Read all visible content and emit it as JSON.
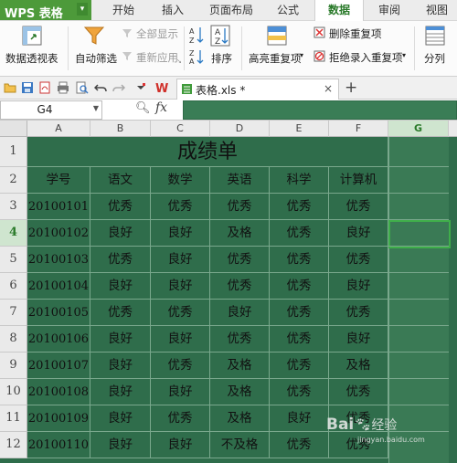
{
  "app": {
    "name": "WPS 表格",
    "caret": "▾"
  },
  "menu_tabs": [
    "开始",
    "插入",
    "页面布局",
    "公式",
    "数据",
    "审阅",
    "视图"
  ],
  "active_tab": "数据",
  "ribbon": {
    "pivot": "数据透视表",
    "autofilter": "自动筛选",
    "show_all": "全部显示",
    "reapply": "重新应用",
    "sort": "排序",
    "highlight_dup": "高亮重复项",
    "remove_dup": "删除重复项",
    "reject_dup": "拒绝录入重复项",
    "split": "分列",
    "dropdown": "▾"
  },
  "document_tab": {
    "name": "表格.xls *",
    "close": "×"
  },
  "new_tab": "+",
  "formula_bar": {
    "cell_ref": "G4",
    "fx": "fx",
    "value": ""
  },
  "columns": [
    "A",
    "B",
    "C",
    "D",
    "E",
    "F",
    "G"
  ],
  "selected_column": "G",
  "selected_row": "4",
  "sheet": {
    "title": "成绩单",
    "headers": [
      "学号",
      "语文",
      "数学",
      "英语",
      "科学",
      "计算机"
    ],
    "rows": [
      {
        "num": "3",
        "cells": [
          "20100101",
          "优秀",
          "优秀",
          "优秀",
          "优秀",
          "优秀"
        ]
      },
      {
        "num": "4",
        "cells": [
          "20100102",
          "良好",
          "良好",
          "及格",
          "优秀",
          "良好"
        ]
      },
      {
        "num": "5",
        "cells": [
          "20100103",
          "优秀",
          "良好",
          "优秀",
          "优秀",
          "优秀"
        ]
      },
      {
        "num": "6",
        "cells": [
          "20100104",
          "良好",
          "良好",
          "优秀",
          "优秀",
          "良好"
        ]
      },
      {
        "num": "7",
        "cells": [
          "20100105",
          "优秀",
          "优秀",
          "良好",
          "优秀",
          "优秀"
        ]
      },
      {
        "num": "8",
        "cells": [
          "20100106",
          "良好",
          "良好",
          "优秀",
          "优秀",
          "良好"
        ]
      },
      {
        "num": "9",
        "cells": [
          "20100107",
          "良好",
          "优秀",
          "及格",
          "优秀",
          "及格"
        ]
      },
      {
        "num": "10",
        "cells": [
          "20100108",
          "良好",
          "良好",
          "及格",
          "优秀",
          "优秀"
        ]
      },
      {
        "num": "11",
        "cells": [
          "20100109",
          "良好",
          "优秀",
          "及格",
          "良好",
          "优秀"
        ]
      },
      {
        "num": "12",
        "cells": [
          "20100110",
          "良好",
          "良好",
          "不及格",
          "优秀",
          "优秀"
        ]
      }
    ]
  },
  "watermark": {
    "text": "Bai",
    "suffix": "经验",
    "url": "jingyan.baidu.com"
  },
  "colors": {
    "sheet_fill": "#2f6d4b",
    "app_green": "#4d9a3a",
    "selection": "#3fae4a"
  }
}
